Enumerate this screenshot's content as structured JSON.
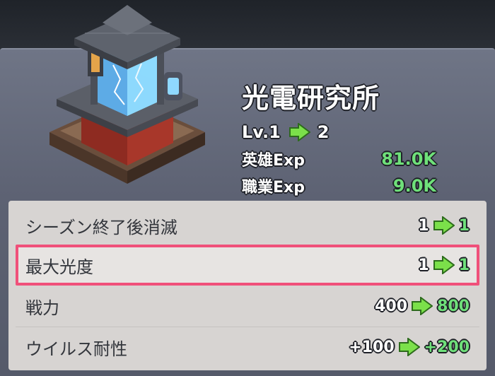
{
  "building": {
    "name": "光電研究所",
    "level_label": "Lv.1",
    "level_next": "2",
    "stats": [
      {
        "label": "英雄Exp",
        "value": "81.0K"
      },
      {
        "label": "職業Exp",
        "value": "9.0K"
      }
    ]
  },
  "upgrades": [
    {
      "name": "シーズン終了後消滅",
      "from": "1",
      "to": "1"
    },
    {
      "name": "最大光度",
      "from": "1",
      "to": "1"
    },
    {
      "name": "戦力",
      "from": "400",
      "to": "800"
    },
    {
      "name": "ウイルス耐性",
      "from": "+100",
      "to": "+200"
    }
  ],
  "colors": {
    "accent_green": "#6fe07a",
    "highlight_border": "#f0507a",
    "panel": "#5d6273"
  },
  "icons": {
    "arrow": "green-right-arrow-icon",
    "building": "lab-building-icon"
  }
}
